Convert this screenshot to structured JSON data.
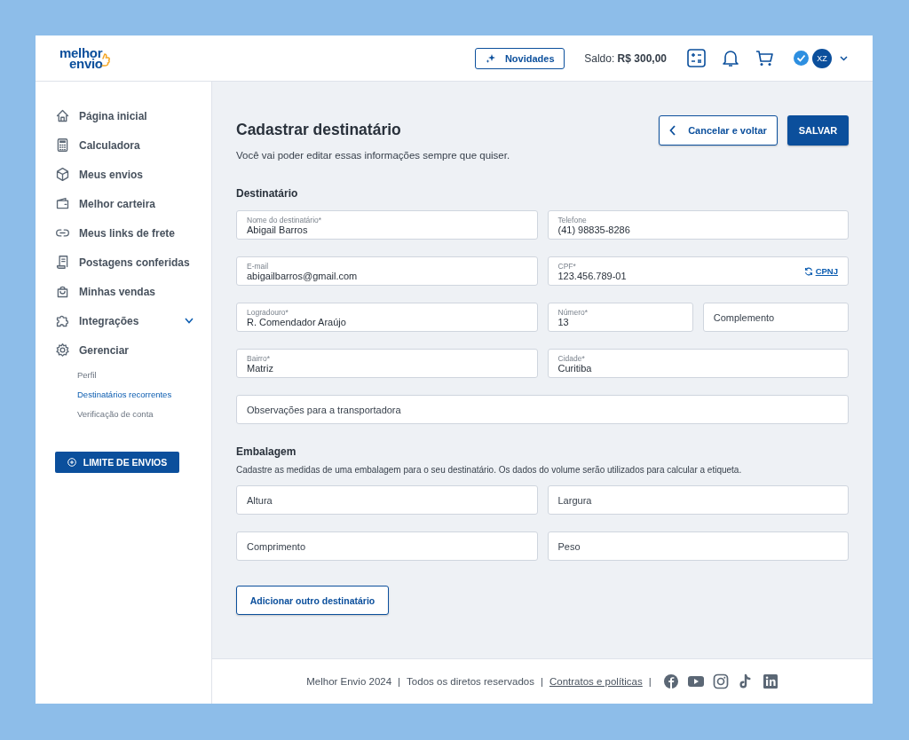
{
  "header": {
    "logo": {
      "line1": "melhor",
      "line2": "envio"
    },
    "news_button": "Novidades",
    "balance": {
      "label": "Saldo:",
      "value": "R$ 300,00"
    },
    "avatar": "XZ",
    "verified": true
  },
  "sidebar": {
    "items": [
      {
        "label": "Página inicial"
      },
      {
        "label": "Calculadora"
      },
      {
        "label": "Meus envios"
      },
      {
        "label": "Melhor carteira"
      },
      {
        "label": "Meus links de frete"
      },
      {
        "label": "Postagens conferidas"
      },
      {
        "label": "Minhas vendas"
      },
      {
        "label": "Integrações",
        "expanded": false
      },
      {
        "label": "Gerenciar",
        "children": [
          {
            "label": "Perfil",
            "selected": false
          },
          {
            "label": "Destinatários recorrentes",
            "selected": true
          },
          {
            "label": "Verificação de conta",
            "selected": false
          }
        ]
      }
    ],
    "limit_button": "LIMITE DE ENVIOS"
  },
  "page": {
    "title": "Cadastrar destinatário",
    "subtitle": "Você vai poder editar essas informações sempre que quiser.",
    "cancel_button": "Cancelar e voltar",
    "save_button": "SALVAR"
  },
  "recipient": {
    "heading": "Destinatário",
    "fields": [
      {
        "label": "Nome do destinatário*",
        "value": "Abigail Barros"
      },
      {
        "label": "Telefone",
        "value": "(41) 98835-8286"
      },
      {
        "label": "E-mail",
        "value": "abigailbarros@gmail.com"
      },
      {
        "label": "CPF*",
        "value": "123.456.789-01",
        "toggle": "CPNJ"
      },
      {
        "label": "Logradouro*",
        "value": "R. Comendador Araújo"
      },
      {
        "label": "Número*",
        "value": "13"
      },
      {
        "placeholder": "Complemento"
      },
      {
        "label": "Bairro*",
        "value": "Matriz"
      },
      {
        "label": "Cidade*",
        "value": "Curitiba"
      },
      {
        "placeholder": "Observações para a transportadora"
      }
    ]
  },
  "package": {
    "heading": "Embalagem",
    "description": "Cadastre as medidas de uma embalagem para o seu destinatário. Os dados do volume serão utilizados para calcular a etiqueta.",
    "fields": [
      {
        "placeholder": "Altura"
      },
      {
        "placeholder": "Largura"
      },
      {
        "placeholder": "Comprimento"
      },
      {
        "placeholder": "Peso"
      }
    ]
  },
  "add_button": "Adicionar outro destinatário",
  "footer": {
    "copyright": "Melhor Envio 2024",
    "rights": "Todos os diretos reservados",
    "policies_link": "Contratos e políticas",
    "separator": "|"
  }
}
